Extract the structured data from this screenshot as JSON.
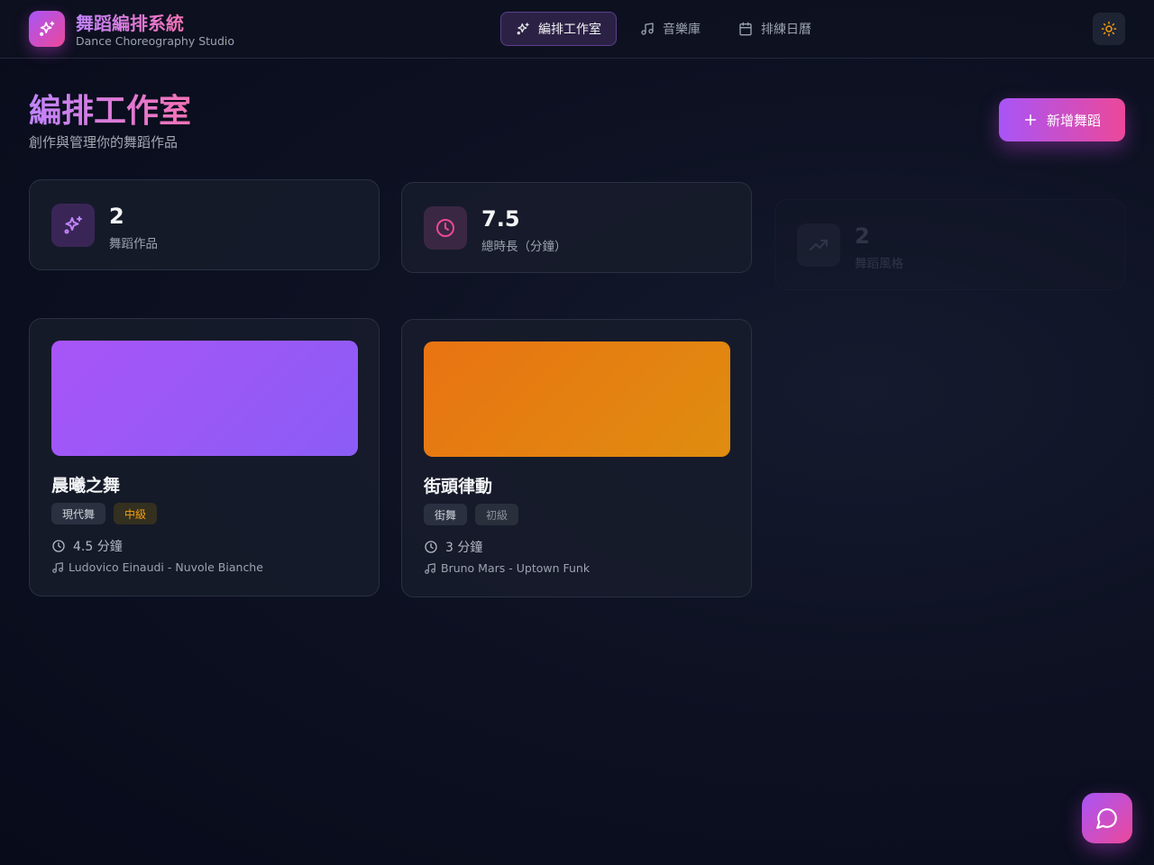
{
  "brand": {
    "title": "舞蹈編排系統",
    "subtitle": "Dance Choreography Studio",
    "logo_icon": "sparkles-icon"
  },
  "nav": [
    {
      "label": "編排工作室",
      "icon": "sparkles-icon",
      "active": true
    },
    {
      "label": "音樂庫",
      "icon": "music-note-icon",
      "active": false
    },
    {
      "label": "排練日曆",
      "icon": "calendar-icon",
      "active": false
    }
  ],
  "theme_toggle": {
    "icon": "sun-icon"
  },
  "page": {
    "title": "編排工作室",
    "subtitle": "創作與管理你的舞蹈作品",
    "add_button_label": "新增舞蹈"
  },
  "stats": [
    {
      "value": "2",
      "label": "舞蹈作品",
      "icon": "sparkles-icon",
      "color": "#c084fc"
    },
    {
      "value": "7.5",
      "label": "總時長（分鐘）",
      "icon": "clock-icon",
      "color": "#ec4899"
    },
    {
      "value": "2",
      "label": "舞蹈風格",
      "icon": "trending-up-icon",
      "color": "#6b7280"
    }
  ],
  "dances": [
    {
      "title": "晨曦之舞",
      "style": "現代舞",
      "level": "中級",
      "level_color": "#f59e0b",
      "duration": "4.5 分鐘",
      "music": "Ludovico Einaudi - Nuvole Bianche",
      "cover_colors": [
        "#a855f7",
        "#8b5cf6"
      ]
    },
    {
      "title": "街頭律動",
      "style": "街舞",
      "level": "初級",
      "level_color": "#9ca3af",
      "duration": "3 分鐘",
      "music": "Bruno Mars - Uptown Funk",
      "cover_colors": [
        "#e97312",
        "#df8d10"
      ]
    }
  ],
  "chat_button": {
    "icon": "chat-bubble-icon"
  },
  "colors": {
    "accent_purple": "#a855f7",
    "accent_pink": "#ec4899",
    "theme_sun": "#f59e0b"
  }
}
